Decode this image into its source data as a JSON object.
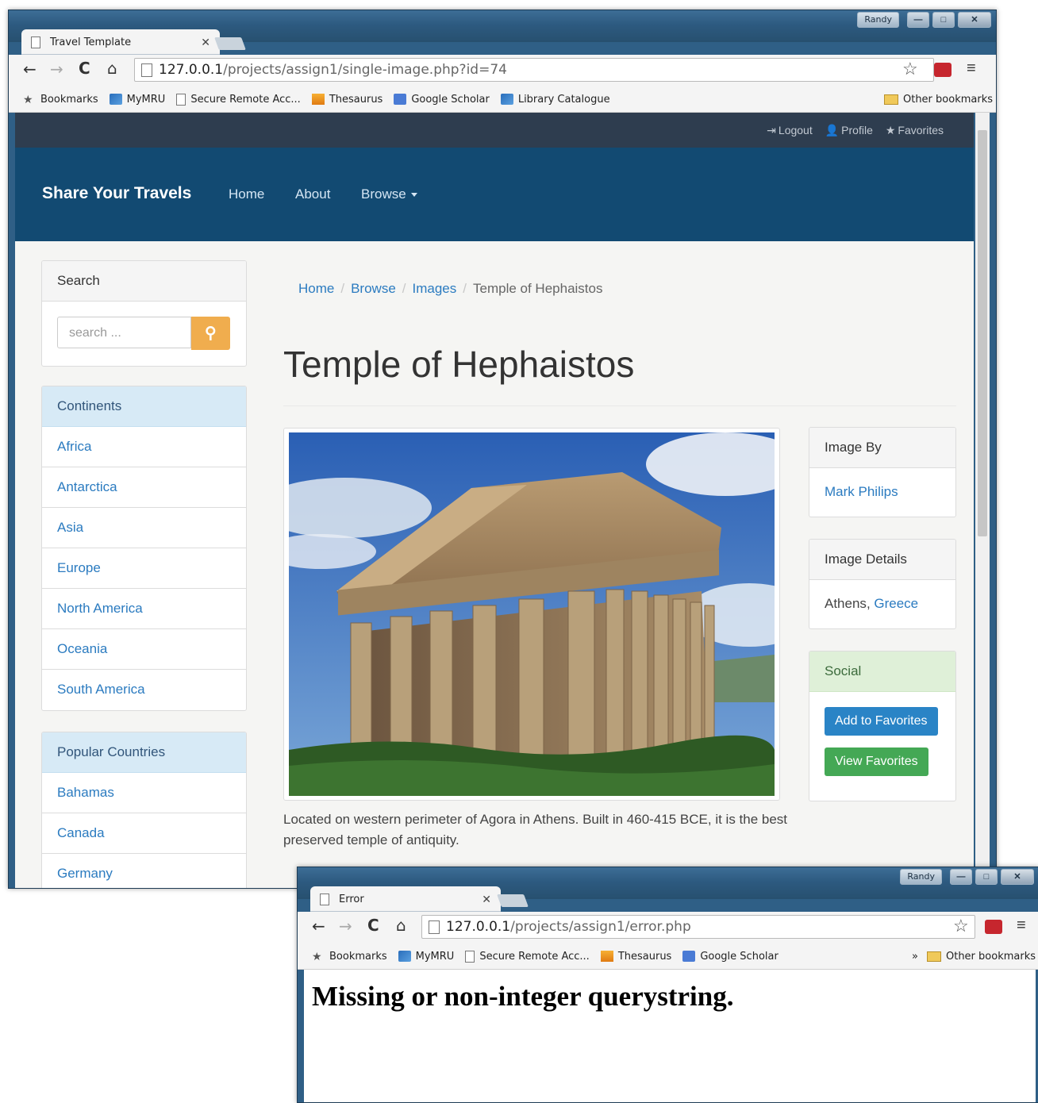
{
  "window1": {
    "user": "Randy",
    "tab_title": "Travel Template",
    "url_host": "127.0.0.1",
    "url_path": "/projects/assign1/single-image.php?id=74",
    "bookmarks": [
      "Bookmarks",
      "MyMRU",
      "Secure Remote Acc...",
      "Thesaurus",
      "Google Scholar",
      "Library Catalogue"
    ],
    "other_bookmarks": "Other bookmarks",
    "topbar": {
      "logout": "Logout",
      "profile": "Profile",
      "favorites": "Favorites"
    },
    "navbar": {
      "brand": "Share Your Travels",
      "home": "Home",
      "about": "About",
      "browse": "Browse"
    },
    "search": {
      "title": "Search",
      "placeholder": "search ..."
    },
    "continents": {
      "title": "Continents",
      "items": [
        "Africa",
        "Antarctica",
        "Asia",
        "Europe",
        "North America",
        "Oceania",
        "South America"
      ]
    },
    "popular": {
      "title": "Popular Countries",
      "items": [
        "Bahamas",
        "Canada",
        "Germany"
      ]
    },
    "breadcrumb": [
      "Home",
      "Browse",
      "Images",
      "Temple of Hephaistos"
    ],
    "page_title": "Temple of Hephaistos",
    "caption": "Located on western perimeter of Agora in Athens. Built in 460-415 BCE, it is the best preserved temple of antiquity.",
    "image_by": {
      "title": "Image By",
      "name": "Mark Philips"
    },
    "image_details": {
      "title": "Image Details",
      "city": "Athens",
      "separator": ", ",
      "country": "Greece"
    },
    "social": {
      "title": "Social",
      "add_fav": "Add to Favorites",
      "view_fav": "View Favorites"
    }
  },
  "window2": {
    "user": "Randy",
    "tab_title": "Error",
    "url_host": "127.0.0.1",
    "url_path": "/projects/assign1/error.php",
    "bookmarks": [
      "Bookmarks",
      "MyMRU",
      "Secure Remote Acc...",
      "Thesaurus",
      "Google Scholar"
    ],
    "more": "»",
    "other_bookmarks": "Other bookmarks",
    "heading": "Missing or non-integer querystring."
  },
  "colors": {
    "navbar": "#124a72",
    "topbar": "#2e3d4f",
    "link": "#2b7bc0",
    "warning": "#f0ad4e",
    "primary": "#2a84c6",
    "success": "#44a855"
  }
}
